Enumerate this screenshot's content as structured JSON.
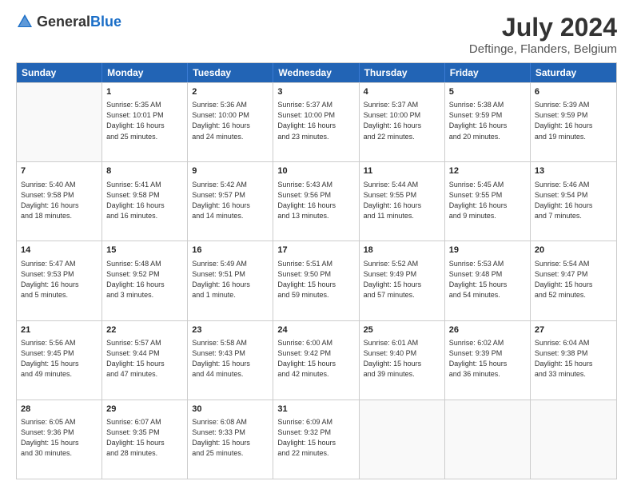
{
  "header": {
    "logo_general": "General",
    "logo_blue": "Blue",
    "title": "July 2024",
    "subtitle": "Deftinge, Flanders, Belgium"
  },
  "days_of_week": [
    "Sunday",
    "Monday",
    "Tuesday",
    "Wednesday",
    "Thursday",
    "Friday",
    "Saturday"
  ],
  "weeks": [
    [
      {
        "num": "",
        "info": ""
      },
      {
        "num": "1",
        "info": "Sunrise: 5:35 AM\nSunset: 10:01 PM\nDaylight: 16 hours\nand 25 minutes."
      },
      {
        "num": "2",
        "info": "Sunrise: 5:36 AM\nSunset: 10:00 PM\nDaylight: 16 hours\nand 24 minutes."
      },
      {
        "num": "3",
        "info": "Sunrise: 5:37 AM\nSunset: 10:00 PM\nDaylight: 16 hours\nand 23 minutes."
      },
      {
        "num": "4",
        "info": "Sunrise: 5:37 AM\nSunset: 10:00 PM\nDaylight: 16 hours\nand 22 minutes."
      },
      {
        "num": "5",
        "info": "Sunrise: 5:38 AM\nSunset: 9:59 PM\nDaylight: 16 hours\nand 20 minutes."
      },
      {
        "num": "6",
        "info": "Sunrise: 5:39 AM\nSunset: 9:59 PM\nDaylight: 16 hours\nand 19 minutes."
      }
    ],
    [
      {
        "num": "7",
        "info": "Sunrise: 5:40 AM\nSunset: 9:58 PM\nDaylight: 16 hours\nand 18 minutes."
      },
      {
        "num": "8",
        "info": "Sunrise: 5:41 AM\nSunset: 9:58 PM\nDaylight: 16 hours\nand 16 minutes."
      },
      {
        "num": "9",
        "info": "Sunrise: 5:42 AM\nSunset: 9:57 PM\nDaylight: 16 hours\nand 14 minutes."
      },
      {
        "num": "10",
        "info": "Sunrise: 5:43 AM\nSunset: 9:56 PM\nDaylight: 16 hours\nand 13 minutes."
      },
      {
        "num": "11",
        "info": "Sunrise: 5:44 AM\nSunset: 9:55 PM\nDaylight: 16 hours\nand 11 minutes."
      },
      {
        "num": "12",
        "info": "Sunrise: 5:45 AM\nSunset: 9:55 PM\nDaylight: 16 hours\nand 9 minutes."
      },
      {
        "num": "13",
        "info": "Sunrise: 5:46 AM\nSunset: 9:54 PM\nDaylight: 16 hours\nand 7 minutes."
      }
    ],
    [
      {
        "num": "14",
        "info": "Sunrise: 5:47 AM\nSunset: 9:53 PM\nDaylight: 16 hours\nand 5 minutes."
      },
      {
        "num": "15",
        "info": "Sunrise: 5:48 AM\nSunset: 9:52 PM\nDaylight: 16 hours\nand 3 minutes."
      },
      {
        "num": "16",
        "info": "Sunrise: 5:49 AM\nSunset: 9:51 PM\nDaylight: 16 hours\nand 1 minute."
      },
      {
        "num": "17",
        "info": "Sunrise: 5:51 AM\nSunset: 9:50 PM\nDaylight: 15 hours\nand 59 minutes."
      },
      {
        "num": "18",
        "info": "Sunrise: 5:52 AM\nSunset: 9:49 PM\nDaylight: 15 hours\nand 57 minutes."
      },
      {
        "num": "19",
        "info": "Sunrise: 5:53 AM\nSunset: 9:48 PM\nDaylight: 15 hours\nand 54 minutes."
      },
      {
        "num": "20",
        "info": "Sunrise: 5:54 AM\nSunset: 9:47 PM\nDaylight: 15 hours\nand 52 minutes."
      }
    ],
    [
      {
        "num": "21",
        "info": "Sunrise: 5:56 AM\nSunset: 9:45 PM\nDaylight: 15 hours\nand 49 minutes."
      },
      {
        "num": "22",
        "info": "Sunrise: 5:57 AM\nSunset: 9:44 PM\nDaylight: 15 hours\nand 47 minutes."
      },
      {
        "num": "23",
        "info": "Sunrise: 5:58 AM\nSunset: 9:43 PM\nDaylight: 15 hours\nand 44 minutes."
      },
      {
        "num": "24",
        "info": "Sunrise: 6:00 AM\nSunset: 9:42 PM\nDaylight: 15 hours\nand 42 minutes."
      },
      {
        "num": "25",
        "info": "Sunrise: 6:01 AM\nSunset: 9:40 PM\nDaylight: 15 hours\nand 39 minutes."
      },
      {
        "num": "26",
        "info": "Sunrise: 6:02 AM\nSunset: 9:39 PM\nDaylight: 15 hours\nand 36 minutes."
      },
      {
        "num": "27",
        "info": "Sunrise: 6:04 AM\nSunset: 9:38 PM\nDaylight: 15 hours\nand 33 minutes."
      }
    ],
    [
      {
        "num": "28",
        "info": "Sunrise: 6:05 AM\nSunset: 9:36 PM\nDaylight: 15 hours\nand 30 minutes."
      },
      {
        "num": "29",
        "info": "Sunrise: 6:07 AM\nSunset: 9:35 PM\nDaylight: 15 hours\nand 28 minutes."
      },
      {
        "num": "30",
        "info": "Sunrise: 6:08 AM\nSunset: 9:33 PM\nDaylight: 15 hours\nand 25 minutes."
      },
      {
        "num": "31",
        "info": "Sunrise: 6:09 AM\nSunset: 9:32 PM\nDaylight: 15 hours\nand 22 minutes."
      },
      {
        "num": "",
        "info": ""
      },
      {
        "num": "",
        "info": ""
      },
      {
        "num": "",
        "info": ""
      }
    ]
  ]
}
